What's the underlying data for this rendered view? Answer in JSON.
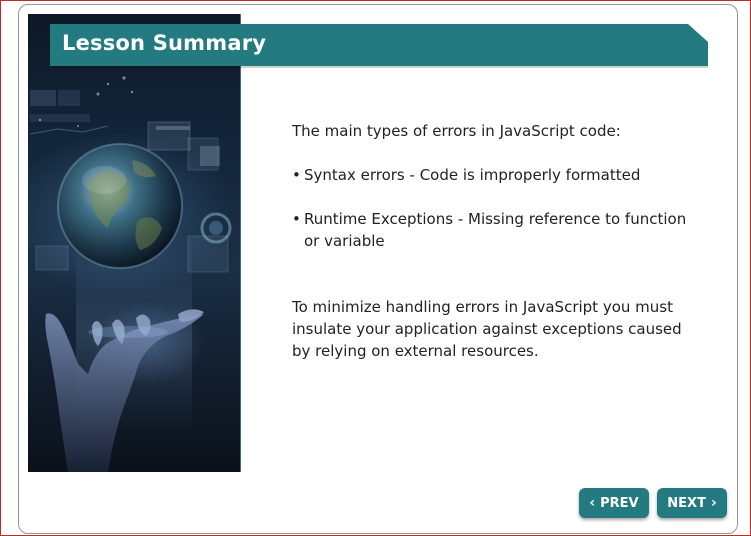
{
  "slide": {
    "title": "Lesson Summary",
    "intro": "The main types of errors in JavaScript code:",
    "bullets": [
      {
        "marker": "•",
        "text": "Syntax errors - Code is improperly formatted"
      },
      {
        "marker": "•",
        "text": "Runtime Exceptions - Missing reference to function or variable"
      }
    ],
    "closing": "To minimize handling errors in JavaScript you must insulate your application against exceptions caused by relying on external resources."
  },
  "navigation": {
    "prev_label": "PREV",
    "next_label": "NEXT",
    "prev_icon": "chevron-left-icon",
    "next_icon": "chevron-right-icon",
    "prev_glyph": "‹",
    "next_glyph": "›"
  },
  "theme": {
    "accent": "#237a80",
    "frame_border": "#8a9aa3",
    "outer_border": "#c62828"
  }
}
